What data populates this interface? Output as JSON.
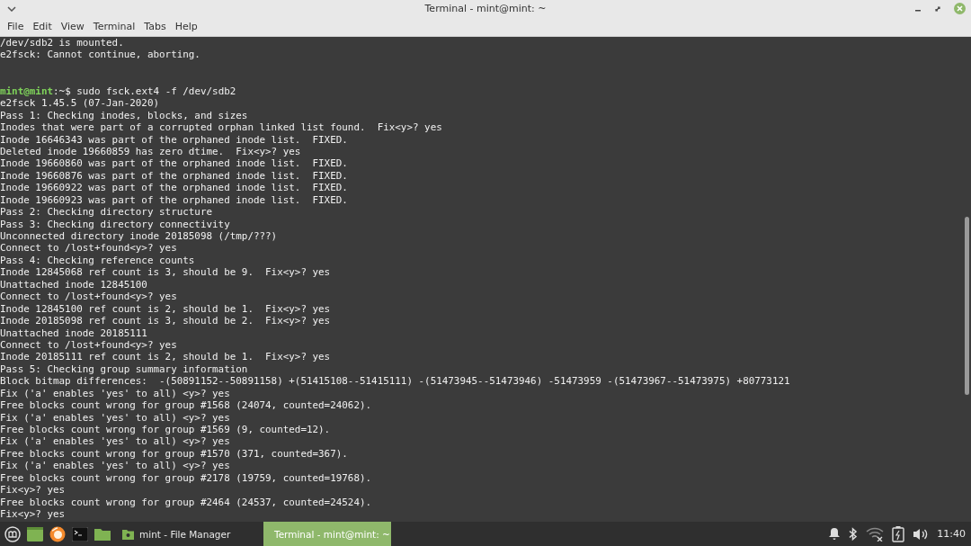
{
  "window": {
    "title": "Terminal - mint@mint: ~"
  },
  "menu": [
    "File",
    "Edit",
    "View",
    "Terminal",
    "Tabs",
    "Help"
  ],
  "terminal": {
    "lines": [
      {
        "kind": "output",
        "text": "/dev/sdb2 is mounted."
      },
      {
        "kind": "output",
        "text": "e2fsck: Cannot continue, aborting."
      },
      {
        "kind": "blank"
      },
      {
        "kind": "blank"
      },
      {
        "kind": "prompt",
        "user": "mint@mint",
        "path": ":~$",
        "text": "sudo fsck.ext4 -f /dev/sdb2"
      },
      {
        "kind": "output",
        "text": "e2fsck 1.45.5 (07-Jan-2020)"
      },
      {
        "kind": "output",
        "text": "Pass 1: Checking inodes, blocks, and sizes"
      },
      {
        "kind": "output",
        "text": "Inodes that were part of a corrupted orphan linked list found.  Fix<y>? yes"
      },
      {
        "kind": "output",
        "text": "Inode 16646343 was part of the orphaned inode list.  FIXED."
      },
      {
        "kind": "output",
        "text": "Deleted inode 19660859 has zero dtime.  Fix<y>? yes"
      },
      {
        "kind": "output",
        "text": "Inode 19660860 was part of the orphaned inode list.  FIXED."
      },
      {
        "kind": "output",
        "text": "Inode 19660876 was part of the orphaned inode list.  FIXED."
      },
      {
        "kind": "output",
        "text": "Inode 19660922 was part of the orphaned inode list.  FIXED."
      },
      {
        "kind": "output",
        "text": "Inode 19660923 was part of the orphaned inode list.  FIXED."
      },
      {
        "kind": "output",
        "text": "Pass 2: Checking directory structure"
      },
      {
        "kind": "output",
        "text": "Pass 3: Checking directory connectivity"
      },
      {
        "kind": "output",
        "text": "Unconnected directory inode 20185098 (/tmp/???)"
      },
      {
        "kind": "output",
        "text": "Connect to /lost+found<y>? yes"
      },
      {
        "kind": "output",
        "text": "Pass 4: Checking reference counts"
      },
      {
        "kind": "output",
        "text": "Inode 12845068 ref count is 3, should be 9.  Fix<y>? yes"
      },
      {
        "kind": "output",
        "text": "Unattached inode 12845100"
      },
      {
        "kind": "output",
        "text": "Connect to /lost+found<y>? yes"
      },
      {
        "kind": "output",
        "text": "Inode 12845100 ref count is 2, should be 1.  Fix<y>? yes"
      },
      {
        "kind": "output",
        "text": "Inode 20185098 ref count is 3, should be 2.  Fix<y>? yes"
      },
      {
        "kind": "output",
        "text": "Unattached inode 20185111"
      },
      {
        "kind": "output",
        "text": "Connect to /lost+found<y>? yes"
      },
      {
        "kind": "output",
        "text": "Inode 20185111 ref count is 2, should be 1.  Fix<y>? yes"
      },
      {
        "kind": "output",
        "text": "Pass 5: Checking group summary information"
      },
      {
        "kind": "output",
        "text": "Block bitmap differences:  -(50891152--50891158) +(51415108--51415111) -(51473945--51473946) -51473959 -(51473967--51473975) +80773121"
      },
      {
        "kind": "output",
        "text": "Fix ('a' enables 'yes' to all) <y>? yes"
      },
      {
        "kind": "output",
        "text": "Free blocks count wrong for group #1568 (24074, counted=24062)."
      },
      {
        "kind": "output",
        "text": "Fix ('a' enables 'yes' to all) <y>? yes"
      },
      {
        "kind": "output",
        "text": "Free blocks count wrong for group #1569 (9, counted=12)."
      },
      {
        "kind": "output",
        "text": "Fix ('a' enables 'yes' to all) <y>? yes"
      },
      {
        "kind": "output",
        "text": "Free blocks count wrong for group #1570 (371, counted=367)."
      },
      {
        "kind": "output",
        "text": "Fix ('a' enables 'yes' to all) <y>? yes"
      },
      {
        "kind": "output",
        "text": "Free blocks count wrong for group #2178 (19759, counted=19768)."
      },
      {
        "kind": "output",
        "text": "Fix<y>? yes"
      },
      {
        "kind": "output",
        "text": "Free blocks count wrong for group #2464 (24537, counted=24524)."
      },
      {
        "kind": "output",
        "text": "Fix<y>? yes"
      }
    ]
  },
  "taskbar": {
    "windows": [
      {
        "label": "mint - File Manager",
        "selected": false,
        "kind": "files"
      },
      {
        "label": "Terminal - mint@mint: ~",
        "selected": true,
        "kind": "terminal"
      }
    ],
    "clock": "11:40"
  }
}
